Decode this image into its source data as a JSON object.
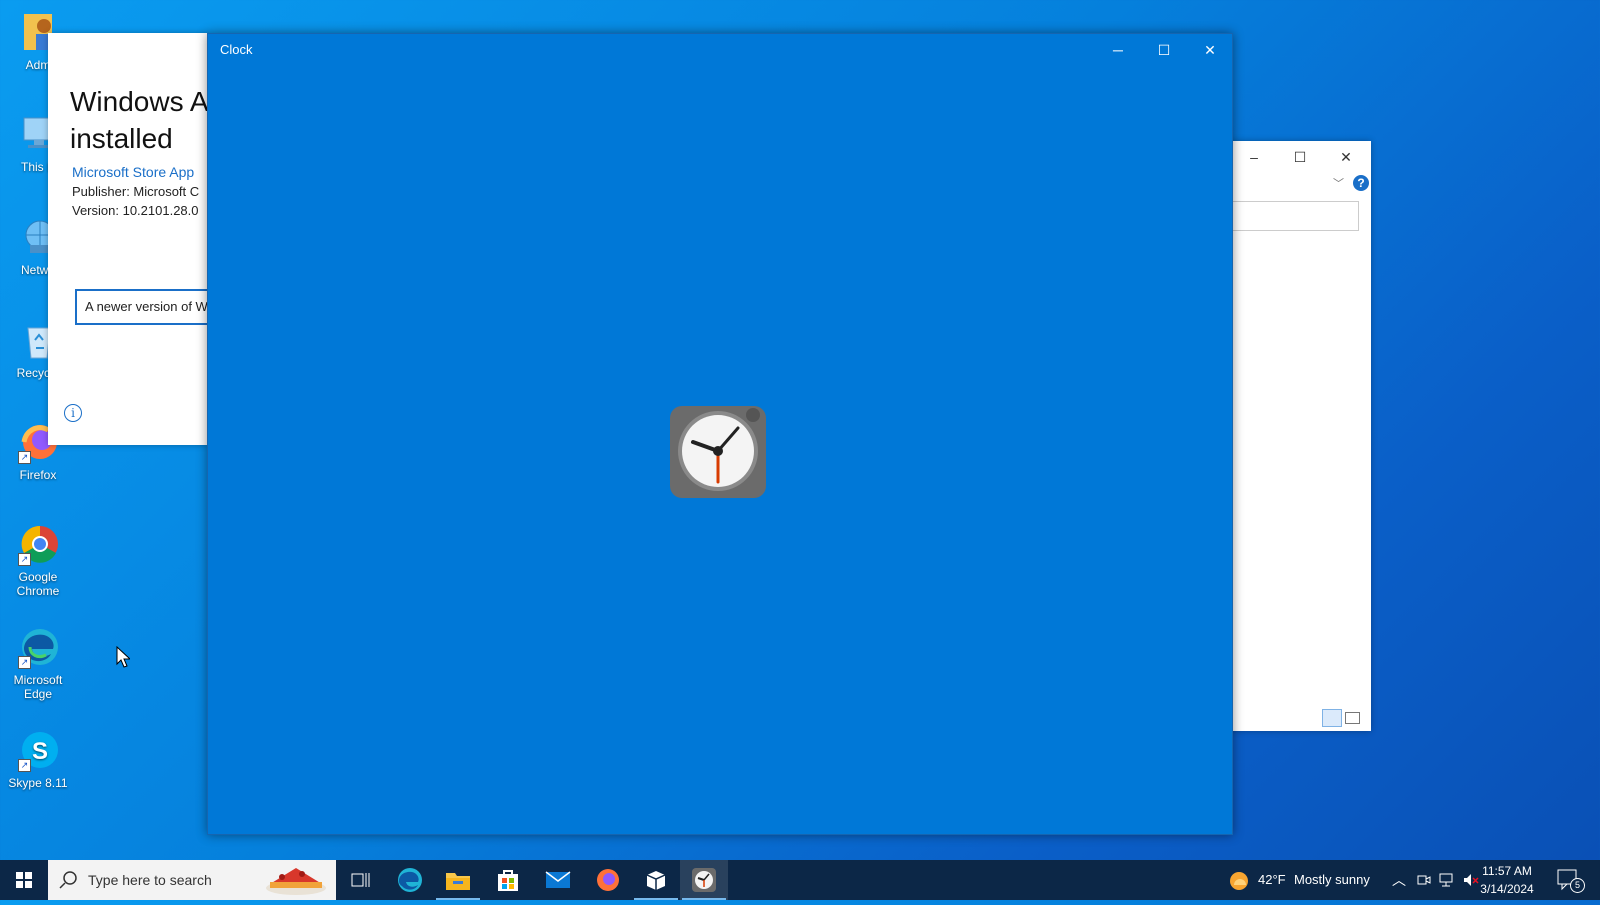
{
  "desktop": {
    "icons": [
      {
        "label": "Adm"
      },
      {
        "label": "This P"
      },
      {
        "label": "Netwo"
      },
      {
        "label": "Recycle"
      },
      {
        "label": "Firefox"
      },
      {
        "label": "Google Chrome"
      },
      {
        "label": "Microsoft Edge"
      },
      {
        "label": "Skype 8.11"
      }
    ]
  },
  "installer": {
    "title_line1": "Windows A",
    "title_line2": "installed",
    "store_link": "Microsoft Store App",
    "publisher": "Publisher: Microsoft C",
    "version": "Version: 10.2101.28.0",
    "notice": "A newer version of W",
    "info_icon": "i"
  },
  "explorer": {
    "minimize": "–",
    "maximize": "☐",
    "close": "✕",
    "help": "?"
  },
  "clock_window": {
    "title": "Clock",
    "minimize_glyph": "─",
    "maximize_glyph": "☐",
    "close_glyph": "✕",
    "splash_icon": "clock-app-icon"
  },
  "taskbar": {
    "search_placeholder": "Type here to search",
    "apps": [
      "task-view",
      "microsoft-edge",
      "file-explorer",
      "microsoft-store",
      "mail",
      "firefox",
      "package-app",
      "clock"
    ],
    "weather_temp": "42°F",
    "weather_desc": "Mostly sunny",
    "time": "11:57 AM",
    "date": "3/14/2024",
    "notification_count": "5"
  },
  "colors": {
    "clock_window_bg": "#0078d7",
    "taskbar_bg": "#0c2747",
    "accent": "#1a6fc8"
  }
}
